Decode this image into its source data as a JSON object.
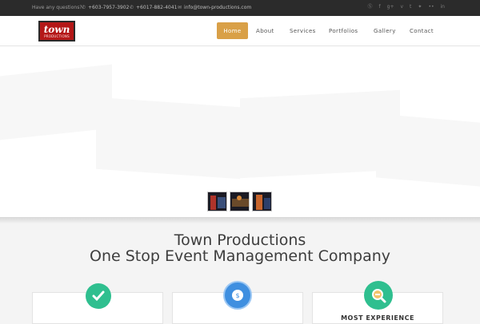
{
  "topbar": {
    "question": "Have any questions?",
    "phone1": "+603-7957-3902",
    "phone2": "+6017-882-4041",
    "email": "info@town-productions.com",
    "social_icons": [
      "skype-icon",
      "facebook-icon",
      "google-plus-icon",
      "vimeo-icon",
      "twitter-icon",
      "plus-icon",
      "flickr-icon",
      "linkedin-icon"
    ]
  },
  "logo": {
    "word": "town",
    "sub": "PRODUCTIONS"
  },
  "nav": {
    "home": "Home",
    "about": "About",
    "services": "Services",
    "portfolios": "Portfolios",
    "gallery": "Gallery",
    "contact": "Contact",
    "active": "Home",
    "accent_color": "#d9a047"
  },
  "hero": {
    "slide_count": 3
  },
  "main": {
    "title_line1": "Town Productions",
    "title_line2": "One Stop Event Management Company"
  },
  "cards": [
    {
      "icon": "checkmark-pen-icon",
      "color": "#2fbf8f"
    },
    {
      "icon": "money-cycle-icon",
      "color": "#3f8fe0"
    },
    {
      "icon": "magnifier-icon",
      "color": "#2fbf8f",
      "label": "MOST EXPERIENCE"
    }
  ]
}
